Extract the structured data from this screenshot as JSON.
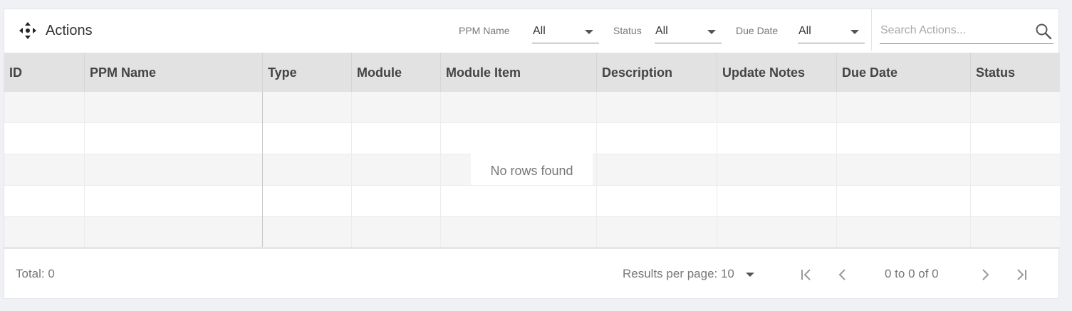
{
  "header": {
    "title": "Actions",
    "icon": "move-arrows-icon",
    "filters": [
      {
        "label": "PPM Name",
        "value": "All"
      },
      {
        "label": "Status",
        "value": "All"
      },
      {
        "label": "Due Date",
        "value": "All"
      }
    ],
    "search": {
      "placeholder": "Search Actions...",
      "value": "",
      "icon": "search-icon"
    }
  },
  "table": {
    "columns": [
      "ID",
      "PPM Name",
      "Type",
      "Module",
      "Module Item",
      "Description",
      "Update Notes",
      "Due Date",
      "Status"
    ],
    "rows": [],
    "empty_message": "No rows found"
  },
  "footer": {
    "total": "Total: 0",
    "results_per_page": "Results per page: 10",
    "page_info": "0 to 0 of 0"
  },
  "colors": {
    "page_bg": "#eff1f4",
    "header_row_bg": "#e2e2e2",
    "odd_row_bg": "#f5f5f5"
  }
}
